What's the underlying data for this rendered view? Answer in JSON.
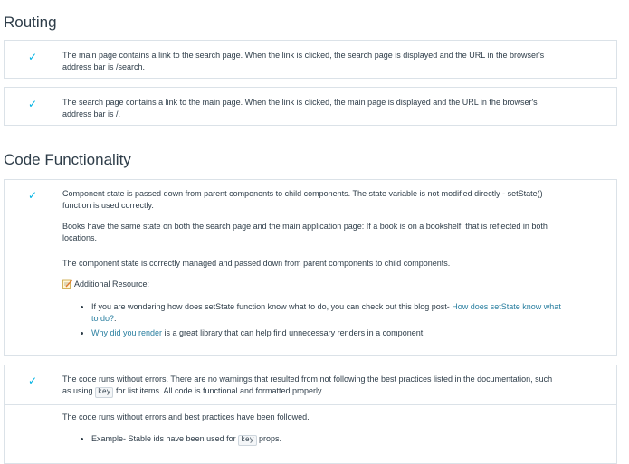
{
  "sections": {
    "routing": {
      "title": "Routing",
      "items": [
        "The main page contains a link to the search page. When the link is clicked, the search page is displayed and the URL in the browser's address bar is /search.",
        "The search page contains a link to the main page. When the link is clicked, the main page is displayed and the URL in the browser's address bar is /."
      ]
    },
    "code_functionality": {
      "title": "Code Functionality",
      "item1": {
        "para1": "Component state is passed down from parent components to child components. The state variable is not modified directly - setState() function is used correctly.",
        "para2": "Books have the same state on both the search page and the main application page: If a book is on a bookshelf, that is reflected in both locations.",
        "review": "The component state is correctly managed and passed down from parent components to child components.",
        "resource_label": "Additional Resource:",
        "bullet1_text": "If you are wondering how does setState function know what to do, you can check out this blog post- ",
        "bullet1_link": "How does setState know what to do?",
        "bullet1_end": ".",
        "bullet2_link": "Why did you render",
        "bullet2_text": " is a great library that can help find unnecessary renders in a component."
      },
      "item2": {
        "para_before": "The code runs without errors. There are no warnings that resulted from not following the best practices listed in the documentation, such as using ",
        "code": "key",
        "para_after": " for list items. All code is functional and formatted properly.",
        "review": "The code runs without errors and best practices have been followed.",
        "bullet_before": "Example- Stable ids have been used for ",
        "bullet_code": "key",
        "bullet_after": " props."
      }
    }
  },
  "icons": {
    "check": "check-icon",
    "resource": "memo-pencil-icon"
  },
  "colors": {
    "check": "#02b3e4",
    "link": "#2a7fa0",
    "border": "#dbe2e8"
  }
}
